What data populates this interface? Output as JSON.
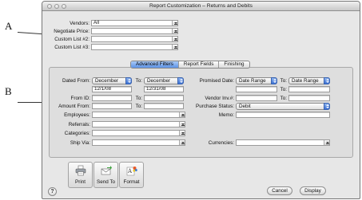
{
  "callouts": {
    "a": "A",
    "b": "B"
  },
  "window": {
    "title": "Report Customization – Returns and Debits"
  },
  "top": {
    "vendors_label": "Vendors:",
    "vendors_value": "All",
    "negotiate_label": "Negotiate Price:",
    "custom2_label": "Custom List #2:",
    "custom3_label": "Custom List #3:"
  },
  "tabs": {
    "advanced": "Advanced Filters",
    "fields": "Report Fields",
    "finishing": "Finishing"
  },
  "filters": {
    "dated_from_label": "Dated From:",
    "dated_from_value": "December",
    "to_label": "To:",
    "dated_to_value": "December",
    "date_from": "12/1/08",
    "date_to": "12/31/08",
    "from_id_label": "From ID:",
    "amount_from_label": "Amount From:",
    "employees_label": "Employees:",
    "referrals_label": "Referrals:",
    "categories_label": "Categories:",
    "ship_via_label": "Ship Via:",
    "promised_label": "Promised Date:",
    "promised_from": "Date Range",
    "promised_to": "Date Range",
    "vendor_inv_label": "Vendor Inv.#:",
    "purchase_status_label": "Purchase Status:",
    "purchase_status_value": "Debit",
    "memo_label": "Memo:",
    "currencies_label": "Currencies:"
  },
  "toolbar": {
    "print": "Print",
    "send_to": "Send To",
    "format": "Format"
  },
  "footer": {
    "help": "?",
    "cancel": "Cancel",
    "display": "Display"
  }
}
